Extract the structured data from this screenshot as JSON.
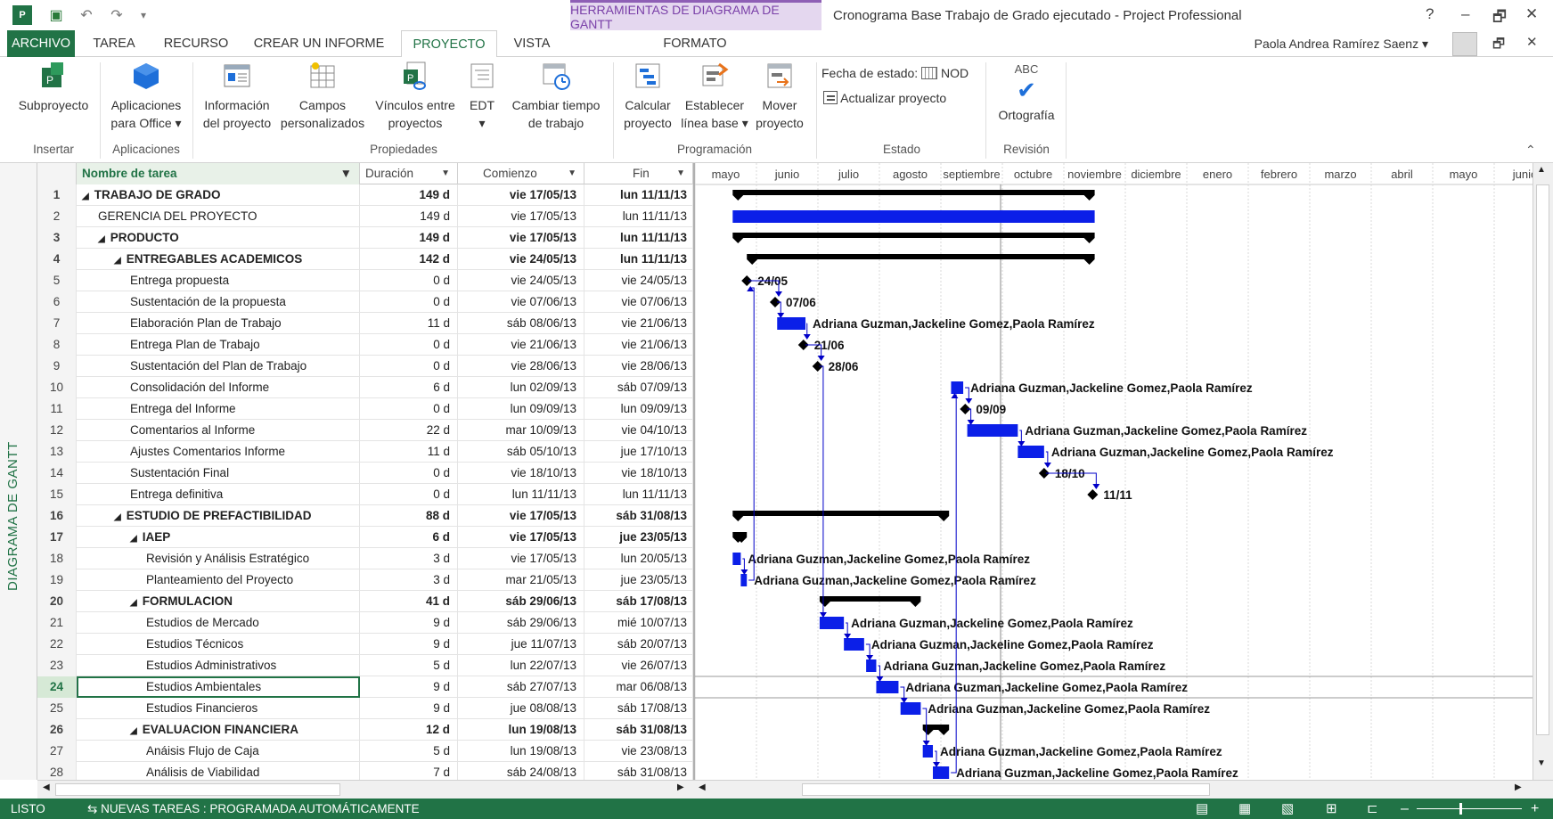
{
  "titlebar": {
    "context_tab": "HERRAMIENTAS DE DIAGRAMA DE GANTT",
    "title": "Cronograma Base Trabajo de Grado ejecutado - Project Professional",
    "help": "?",
    "minimize": "–",
    "restore": "🗗",
    "close": "✕"
  },
  "tabs": {
    "archivo": "ARCHIVO",
    "tarea": "TAREA",
    "recurso": "RECURSO",
    "informe": "CREAR UN INFORME",
    "proyecto": "PROYECTO",
    "vista": "VISTA",
    "formato": "FORMATO"
  },
  "user": {
    "name": "Paola Andrea Ramírez Saenz"
  },
  "ribbon": {
    "subproyecto": "Subproyecto",
    "aplicaciones1": "Aplicaciones",
    "aplicaciones2": "para Office ▾",
    "info1": "Información",
    "info2": "del proyecto",
    "campos1": "Campos",
    "campos2": "personalizados",
    "vinculos1": "Vínculos entre",
    "vinculos2": "proyectos",
    "edt1": "EDT",
    "edt2": "▾",
    "cambiar1": "Cambiar tiempo",
    "cambiar2": "de trabajo",
    "calcular1": "Calcular",
    "calcular2": "proyecto",
    "establecer1": "Establecer",
    "establecer2": "línea base ▾",
    "mover1": "Mover",
    "mover2": "proyecto",
    "fecha_estado": "Fecha de estado:",
    "fecha_valor": "NOD",
    "actualizar": "Actualizar proyecto",
    "abc": "ABC",
    "ortografia": "Ortografía",
    "groups": {
      "insertar": "Insertar",
      "aplicaciones": "Aplicaciones",
      "propiedades": "Propiedades",
      "programacion": "Programación",
      "estado": "Estado",
      "revision": "Revisión"
    }
  },
  "sidebar_label": "DIAGRAMA DE GANTT",
  "grid": {
    "headers": {
      "name": "Nombre de tarea",
      "dur": "Duración",
      "start": "Comienzo",
      "fin": "Fin"
    },
    "rows": [
      {
        "id": "1",
        "name": "TRABAJO DE GRADO",
        "dur": "149 d",
        "start": "vie 17/05/13",
        "fin": "lun 11/11/13",
        "level": 0,
        "sum": true
      },
      {
        "id": "2",
        "name": "GERENCIA DEL PROYECTO",
        "dur": "149 d",
        "start": "vie 17/05/13",
        "fin": "lun 11/11/13",
        "level": 1,
        "sum": false
      },
      {
        "id": "3",
        "name": "PRODUCTO",
        "dur": "149 d",
        "start": "vie 17/05/13",
        "fin": "lun 11/11/13",
        "level": 1,
        "sum": true
      },
      {
        "id": "4",
        "name": "ENTREGABLES ACADEMICOS",
        "dur": "142 d",
        "start": "vie 24/05/13",
        "fin": "lun 11/11/13",
        "level": 2,
        "sum": true
      },
      {
        "id": "5",
        "name": "Entrega propuesta",
        "dur": "0 d",
        "start": "vie 24/05/13",
        "fin": "vie 24/05/13",
        "level": 3,
        "sum": false
      },
      {
        "id": "6",
        "name": "Sustentación de la propuesta",
        "dur": "0 d",
        "start": "vie 07/06/13",
        "fin": "vie 07/06/13",
        "level": 3,
        "sum": false
      },
      {
        "id": "7",
        "name": "Elaboración Plan de Trabajo",
        "dur": "11 d",
        "start": "sáb 08/06/13",
        "fin": "vie 21/06/13",
        "level": 3,
        "sum": false
      },
      {
        "id": "8",
        "name": "Entrega Plan de Trabajo",
        "dur": "0 d",
        "start": "vie 21/06/13",
        "fin": "vie 21/06/13",
        "level": 3,
        "sum": false
      },
      {
        "id": "9",
        "name": "Sustentación del Plan de Trabajo",
        "dur": "0 d",
        "start": "vie 28/06/13",
        "fin": "vie 28/06/13",
        "level": 3,
        "sum": false
      },
      {
        "id": "10",
        "name": "Consolidación del Informe",
        "dur": "6 d",
        "start": "lun 02/09/13",
        "fin": "sáb 07/09/13",
        "level": 3,
        "sum": false
      },
      {
        "id": "11",
        "name": "Entrega del Informe",
        "dur": "0 d",
        "start": "lun 09/09/13",
        "fin": "lun 09/09/13",
        "level": 3,
        "sum": false
      },
      {
        "id": "12",
        "name": "Comentarios al Informe",
        "dur": "22 d",
        "start": "mar 10/09/13",
        "fin": "vie 04/10/13",
        "level": 3,
        "sum": false
      },
      {
        "id": "13",
        "name": "Ajustes Comentarios Informe",
        "dur": "11 d",
        "start": "sáb 05/10/13",
        "fin": "jue 17/10/13",
        "level": 3,
        "sum": false
      },
      {
        "id": "14",
        "name": "Sustentación Final",
        "dur": "0 d",
        "start": "vie 18/10/13",
        "fin": "vie 18/10/13",
        "level": 3,
        "sum": false
      },
      {
        "id": "15",
        "name": "Entrega definitiva",
        "dur": "0 d",
        "start": "lun 11/11/13",
        "fin": "lun 11/11/13",
        "level": 3,
        "sum": false
      },
      {
        "id": "16",
        "name": "ESTUDIO DE PREFACTIBILIDAD",
        "dur": "88 d",
        "start": "vie 17/05/13",
        "fin": "sáb 31/08/13",
        "level": 2,
        "sum": true
      },
      {
        "id": "17",
        "name": "IAEP",
        "dur": "6 d",
        "start": "vie 17/05/13",
        "fin": "jue 23/05/13",
        "level": 3,
        "sum": true
      },
      {
        "id": "18",
        "name": "Revisión y Análisis Estratégico",
        "dur": "3 d",
        "start": "vie 17/05/13",
        "fin": "lun 20/05/13",
        "level": 4,
        "sum": false
      },
      {
        "id": "19",
        "name": "Planteamiento del Proyecto",
        "dur": "3 d",
        "start": "mar 21/05/13",
        "fin": "jue 23/05/13",
        "level": 4,
        "sum": false
      },
      {
        "id": "20",
        "name": "FORMULACION",
        "dur": "41 d",
        "start": "sáb 29/06/13",
        "fin": "sáb 17/08/13",
        "level": 3,
        "sum": true
      },
      {
        "id": "21",
        "name": "Estudios de Mercado",
        "dur": "9 d",
        "start": "sáb 29/06/13",
        "fin": "mié 10/07/13",
        "level": 4,
        "sum": false
      },
      {
        "id": "22",
        "name": "Estudios Técnicos",
        "dur": "9 d",
        "start": "jue 11/07/13",
        "fin": "sáb 20/07/13",
        "level": 4,
        "sum": false
      },
      {
        "id": "23",
        "name": "Estudios Administrativos",
        "dur": "5 d",
        "start": "lun 22/07/13",
        "fin": "vie 26/07/13",
        "level": 4,
        "sum": false
      },
      {
        "id": "24",
        "name": "Estudios Ambientales",
        "dur": "9 d",
        "start": "sáb 27/07/13",
        "fin": "mar 06/08/13",
        "level": 4,
        "sum": false
      },
      {
        "id": "25",
        "name": "Estudios Financieros",
        "dur": "9 d",
        "start": "jue 08/08/13",
        "fin": "sáb 17/08/13",
        "level": 4,
        "sum": false
      },
      {
        "id": "26",
        "name": "EVALUACION FINANCIERA",
        "dur": "12 d",
        "start": "lun 19/08/13",
        "fin": "sáb 31/08/13",
        "level": 3,
        "sum": true
      },
      {
        "id": "27",
        "name": "Anáisis Flujo de Caja",
        "dur": "5 d",
        "start": "lun 19/08/13",
        "fin": "vie 23/08/13",
        "level": 4,
        "sum": false
      },
      {
        "id": "28",
        "name": "Análisis de Viabilidad",
        "dur": "7 d",
        "start": "sáb 24/08/13",
        "fin": "sáb 31/08/13",
        "level": 4,
        "sum": false
      }
    ],
    "selected_id": "24"
  },
  "gantt": {
    "months": [
      "mayo",
      "junio",
      "julio",
      "agosto",
      "septiembre",
      "octubre",
      "noviembre",
      "diciembre",
      "enero",
      "febrero",
      "marzo",
      "abril",
      "mayo",
      "junio"
    ],
    "timeline_start": "2013-05-01",
    "resources": "Adriana Guzman,Jackeline Gomez,Paola Ramírez",
    "milestone_labels": {
      "5": "24/05",
      "6": "07/06",
      "8": "21/06",
      "9": "28/06",
      "11": "09/09",
      "14": "18/10",
      "15": "11/11"
    },
    "colors": {
      "task": "#0b1fe8",
      "summary": "#000000",
      "link": "#0000c8"
    }
  },
  "status": {
    "ready": "LISTO",
    "new_tasks": "NUEVAS TAREAS : PROGRAMADA AUTOMÁTICAMENTE",
    "zoom_minus": "–",
    "zoom_plus": "+"
  }
}
